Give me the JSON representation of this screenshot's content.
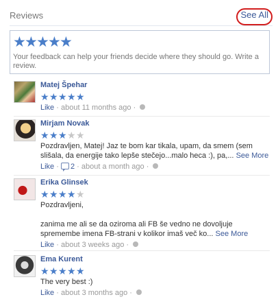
{
  "header": {
    "title": "Reviews",
    "see_all_label": "See All"
  },
  "composer": {
    "rating_stars": 5,
    "prompt": "Your feedback can help your friends decide where they should go. Write a review."
  },
  "reviews": [
    {
      "name": "Matej Špehar",
      "rating": 5,
      "text": "",
      "like_label": "Like",
      "comments": "",
      "time": "about 11 months ago",
      "see_more": ""
    },
    {
      "name": "Mirjam Novak",
      "rating": 3,
      "text": "Pozdravljen, Matej! Jaz te bom kar tikala, upam, da smem (sem slišala, da energije tako lepše stečejo...malo heca :), pa,...",
      "like_label": "Like",
      "comments": "2",
      "time": "about a month ago",
      "see_more": "See More"
    },
    {
      "name": "Erika Glinsek",
      "rating": 4,
      "text": "Pozdravljeni,",
      "text2": "zanima me ali se da oziroma ali FB še vedno ne dovoljuje spremembe imena FB-strani v kolikor imaš več ko...",
      "like_label": "Like",
      "comments": "",
      "time": "about 3 weeks ago",
      "see_more": "See More"
    },
    {
      "name": "Ema Kurent",
      "rating": 5,
      "text": "The very best :)",
      "like_label": "Like",
      "comments": "",
      "time": "about 3 months ago",
      "see_more": ""
    }
  ],
  "separator": "·",
  "colors": {
    "link": "#3b5998",
    "star_on": "#4a7ec9",
    "star_off": "#c7c7c7",
    "highlight_ring": "#d21d1d"
  }
}
